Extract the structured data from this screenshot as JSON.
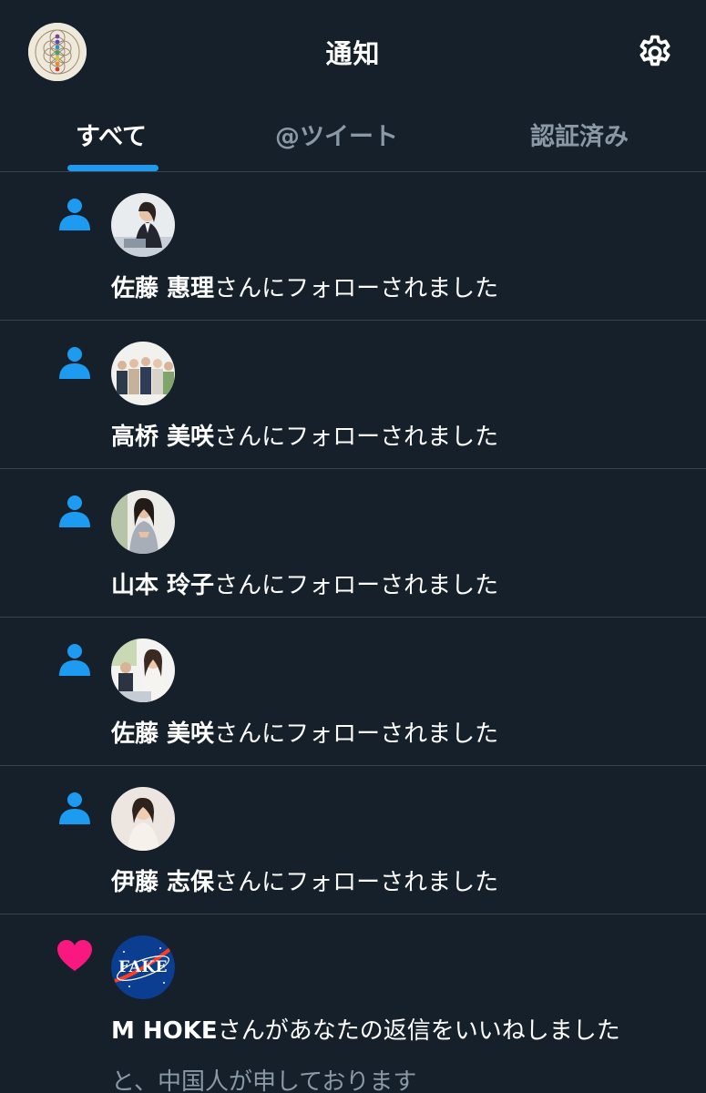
{
  "header": {
    "title": "通知",
    "avatar_icon": "flower-of-life-avatar",
    "settings_icon": "gear-icon"
  },
  "tabs": [
    {
      "label": "すべて",
      "active": true
    },
    {
      "label": "@ツイート",
      "active": false
    },
    {
      "label": "認証済み",
      "active": false
    }
  ],
  "notifications": [
    {
      "type": "follow",
      "icon": "person-icon",
      "name": "佐藤 惠理",
      "text": "さんにフォローされました"
    },
    {
      "type": "follow",
      "icon": "person-icon",
      "name": "高桥 美咲",
      "text": "さんにフォローされました"
    },
    {
      "type": "follow",
      "icon": "person-icon",
      "name": "山本 玲子",
      "text": "さんにフォローされました"
    },
    {
      "type": "follow",
      "icon": "person-icon",
      "name": "佐藤 美咲",
      "text": "さんにフォローされました"
    },
    {
      "type": "follow",
      "icon": "person-icon",
      "name": "伊藤 志保",
      "text": "さんにフォローされました"
    },
    {
      "type": "like",
      "icon": "heart-icon",
      "name": "M HOKE",
      "text": "さんがあなたの返信をいいねしました",
      "snippet": "と、中国人が申しております",
      "avatar_label": "FAKE"
    }
  ],
  "colors": {
    "background": "#15202b",
    "accent": "#1d9bf0",
    "like": "#f91880",
    "divider": "#38444d",
    "muted": "#8b98a5"
  }
}
